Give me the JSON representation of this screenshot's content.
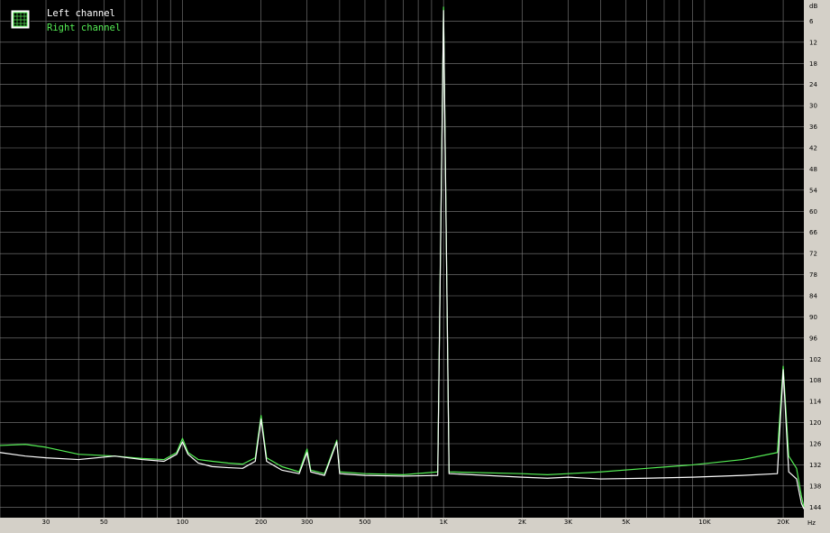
{
  "chart_data": {
    "type": "line",
    "xlabel": "Hz",
    "ylabel": "dB",
    "xscale": "log",
    "xlim": [
      20,
      24000
    ],
    "ylim": [
      -147,
      0
    ],
    "background": "#000000",
    "grid": true,
    "grid_color": "#808080",
    "legend_position": "top-left",
    "x_ticks": [
      {
        "value": 30,
        "label": "30"
      },
      {
        "value": 50,
        "label": "50"
      },
      {
        "value": 100,
        "label": "100"
      },
      {
        "value": 200,
        "label": "200"
      },
      {
        "value": 300,
        "label": "300"
      },
      {
        "value": 500,
        "label": "500"
      },
      {
        "value": 1000,
        "label": "1K"
      },
      {
        "value": 2000,
        "label": "2K"
      },
      {
        "value": 3000,
        "label": "3K"
      },
      {
        "value": 5000,
        "label": "5K"
      },
      {
        "value": 10000,
        "label": "10K"
      },
      {
        "value": 20000,
        "label": "20K"
      }
    ],
    "y_ticks": [
      -6,
      -12,
      -18,
      -24,
      -30,
      -36,
      -42,
      -48,
      -54,
      -60,
      -66,
      -72,
      -78,
      -84,
      -90,
      -96,
      -102,
      -108,
      -114,
      -120,
      -126,
      -132,
      -138,
      -144
    ],
    "y_tick_labels": [
      "6",
      "12",
      "18",
      "24",
      "30",
      "36",
      "42",
      "48",
      "54",
      "60",
      "66",
      "72",
      "78",
      "84",
      "90",
      "96",
      "102",
      "108",
      "114",
      "120",
      "126",
      "132",
      "138",
      "144"
    ],
    "series": [
      {
        "name": "Left channel",
        "color": "#ffffff",
        "points": [
          [
            20,
            -128.5
          ],
          [
            25,
            -129.5
          ],
          [
            30,
            -130
          ],
          [
            40,
            -130.5
          ],
          [
            55,
            -129.5
          ],
          [
            70,
            -130.5
          ],
          [
            85,
            -131
          ],
          [
            95,
            -129
          ],
          [
            100,
            -125.5
          ],
          [
            105,
            -129
          ],
          [
            115,
            -131.5
          ],
          [
            130,
            -132.5
          ],
          [
            150,
            -132.8
          ],
          [
            170,
            -133
          ],
          [
            190,
            -131
          ],
          [
            200,
            -119
          ],
          [
            210,
            -131
          ],
          [
            240,
            -133.5
          ],
          [
            280,
            -134.5
          ],
          [
            300,
            -128.5
          ],
          [
            310,
            -134
          ],
          [
            350,
            -135
          ],
          [
            390,
            -125.5
          ],
          [
            400,
            -134.5
          ],
          [
            500,
            -135
          ],
          [
            700,
            -135.2
          ],
          [
            950,
            -135
          ],
          [
            1000,
            -3
          ],
          [
            1050,
            -134.5
          ],
          [
            2000,
            -135.5
          ],
          [
            2500,
            -135.8
          ],
          [
            3000,
            -135.5
          ],
          [
            4000,
            -136
          ],
          [
            6000,
            -135.8
          ],
          [
            9000,
            -135.5
          ],
          [
            14000,
            -135
          ],
          [
            19000,
            -134.5
          ],
          [
            20000,
            -105
          ],
          [
            21000,
            -134
          ],
          [
            22500,
            -136
          ],
          [
            23500,
            -143
          ],
          [
            24000,
            -144.5
          ]
        ]
      },
      {
        "name": "Right channel",
        "color": "#55ee55",
        "points": [
          [
            20,
            -126.5
          ],
          [
            25,
            -126.2
          ],
          [
            30,
            -127
          ],
          [
            40,
            -129
          ],
          [
            55,
            -129.5
          ],
          [
            70,
            -130.2
          ],
          [
            85,
            -130.5
          ],
          [
            95,
            -128.5
          ],
          [
            100,
            -124.5
          ],
          [
            105,
            -128.5
          ],
          [
            115,
            -130.5
          ],
          [
            130,
            -131
          ],
          [
            150,
            -131.5
          ],
          [
            170,
            -131.8
          ],
          [
            190,
            -130
          ],
          [
            200,
            -118
          ],
          [
            210,
            -130
          ],
          [
            240,
            -132.5
          ],
          [
            280,
            -134
          ],
          [
            300,
            -127.5
          ],
          [
            310,
            -133.5
          ],
          [
            350,
            -134.5
          ],
          [
            390,
            -125
          ],
          [
            400,
            -134
          ],
          [
            500,
            -134.5
          ],
          [
            700,
            -134.8
          ],
          [
            950,
            -134
          ],
          [
            1000,
            -2
          ],
          [
            1050,
            -134
          ],
          [
            2000,
            -134.5
          ],
          [
            2500,
            -134.8
          ],
          [
            3000,
            -134.5
          ],
          [
            4000,
            -134
          ],
          [
            6000,
            -133
          ],
          [
            9000,
            -132
          ],
          [
            14000,
            -130.5
          ],
          [
            19000,
            -128.5
          ],
          [
            20000,
            -104
          ],
          [
            21000,
            -129.5
          ],
          [
            22500,
            -133
          ],
          [
            23500,
            -141
          ],
          [
            24000,
            -144
          ]
        ]
      }
    ]
  }
}
